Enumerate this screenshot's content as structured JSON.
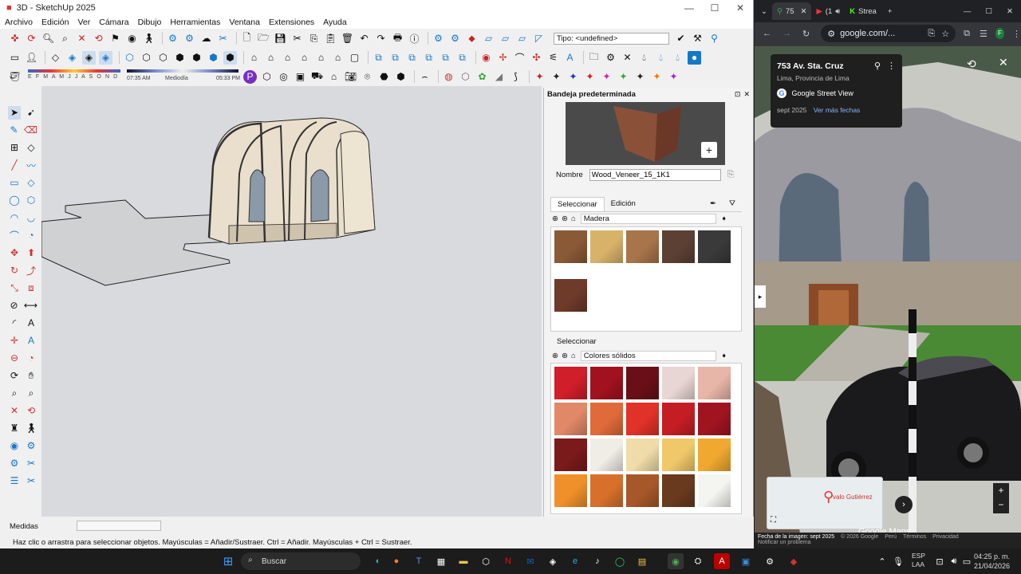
{
  "sketchup": {
    "title": "3D - SketchUp 2025",
    "menu": [
      "Archivo",
      "Edición",
      "Ver",
      "Cámara",
      "Dibujo",
      "Herramientas",
      "Ventana",
      "Extensiones",
      "Ayuda"
    ],
    "tipo_label": "Tipo: <undefined>",
    "shadow": {
      "months": "E F M A M J J A S O N D",
      "time_start": "07:35 AM",
      "mid_label": "Mediodía",
      "time_end": "05:33 PM"
    },
    "tray": {
      "title": "Bandeja predeterminada",
      "name_label": "Nombre",
      "name_value": "Wood_Veneer_15_1K1",
      "tab_select": "Seleccionar",
      "tab_edit": "Edición",
      "collection1": "Madera",
      "section2_label": "Seleccionar",
      "collection2": "Colores sólidos",
      "wood_colors": [
        "#8a5a36",
        "#d9b26a",
        "#a8744a",
        "#5d4034",
        "#3a3a3a",
        "#6e3a2a"
      ],
      "solid_colors": [
        "#d01e2a",
        "#a1121e",
        "#6a0f18",
        "#e8d6d4",
        "#e8b6a8",
        "#e08868",
        "#e06a3a",
        "#e03228",
        "#c41e24",
        "#a01420",
        "#7a1a1a",
        "#f0ece6",
        "#f0dca8",
        "#f0c86a",
        "#f0a830",
        "#f0902a",
        "#d8702c",
        "#a6582a",
        "#6a3a1e",
        "#f4f4f0"
      ]
    },
    "status": {
      "measures_label": "Medidas",
      "hint": "Haz clic o arrastra para seleccionar objetos. Mayúsculas = Añadir/Sustraer. Ctrl = Añadir. Mayúsculas + Ctrl = Sustraer."
    }
  },
  "chrome": {
    "tabs": [
      {
        "label": "75"
      },
      {
        "label": "(1"
      },
      {
        "label": "Strea"
      }
    ],
    "url": "google.com/...",
    "streetview": {
      "address": "753 Av. Sta. Cruz",
      "locality": "Lima, Provincia de Lima",
      "service": "Google Street View",
      "date": "sept 2025",
      "more_dates": "Ver más fechas",
      "map_label": "valo Gutiérrez",
      "brand": "Google Maps",
      "footer": {
        "capture": "Fecha de la imagen: sept 2025",
        "copyright": "© 2026 Google",
        "country": "Perú",
        "terms": "Términos",
        "privacy": "Privacidad",
        "report": "Notificar un problema"
      }
    }
  },
  "taskbar": {
    "search": "Buscar",
    "lang": "ESP",
    "lang2": "LAA",
    "time": "04:25 p. m.",
    "date": "21/04/2026"
  }
}
